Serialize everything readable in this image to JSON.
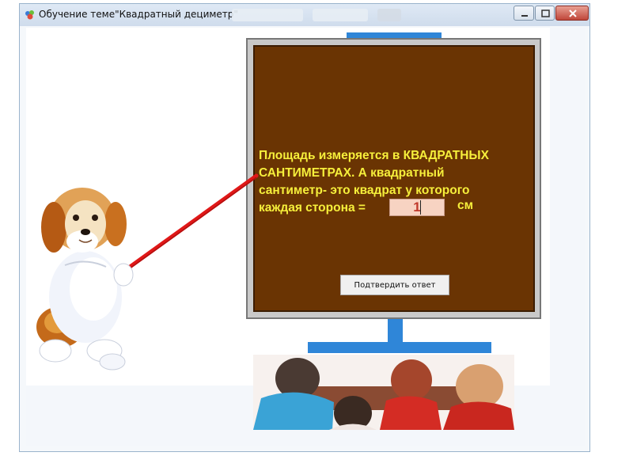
{
  "window": {
    "title": "Обучение теме\"Квадратный дециметр\"",
    "icon": "app-icon",
    "controls": [
      "minimize-icon",
      "maximize-icon",
      "close-icon"
    ]
  },
  "board": {
    "lines": [
      "Площадь измеряется в КВАДРАТНЫХ",
      "САНТИМЕТРАХ. А квадратный",
      "сантиметр- это квадрат у которого"
    ],
    "last_line_prefix": "каждая сторона =",
    "answer_value": "1",
    "unit": "см",
    "confirm_label": "Подтвердить ответ"
  },
  "colors": {
    "board": "#6a3403",
    "text": "#f6ef3b",
    "stand": "#2f86d8",
    "pointer": "#e01818"
  },
  "images": [
    "dog-illustration",
    "children-photo",
    "pointer-stick"
  ]
}
